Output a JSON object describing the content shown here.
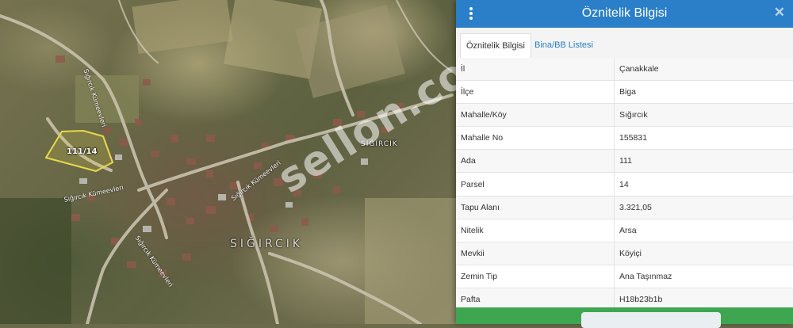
{
  "map": {
    "village_label": "SIĞIRCIK",
    "village_label_large": "SIĞIRCIK",
    "parcel_label": "111/14",
    "watermark": "sellon.com",
    "street_1": "Sığırcık Kümeevleri",
    "street_2": "Sığırcık Kümeevleri",
    "street_3": "Sığırcık Kümeevleri",
    "street_4": "Sığırcık Kümeevleri"
  },
  "panel": {
    "title": "Öznitelik Bilgisi",
    "tabs": [
      {
        "label": "Öznitelik Bilgisi",
        "active": true
      },
      {
        "label": "Bina/BB Listesi",
        "active": false
      }
    ],
    "rows": [
      {
        "key": "İl",
        "value": "Çanakkale"
      },
      {
        "key": "İlçe",
        "value": "Biga"
      },
      {
        "key": "Mahalle/Köy",
        "value": "Sığırcık"
      },
      {
        "key": "Mahalle No",
        "value": "155831"
      },
      {
        "key": "Ada",
        "value": "111"
      },
      {
        "key": "Parsel",
        "value": "14"
      },
      {
        "key": "Tapu Alanı",
        "value": "3.321,05"
      },
      {
        "key": "Nitelik",
        "value": "Arsa"
      },
      {
        "key": "Mevkii",
        "value": "Köyiçi"
      },
      {
        "key": "Zemin Tip",
        "value": "Ana Taşınmaz"
      },
      {
        "key": "Pafta",
        "value": "H18b23b1b"
      }
    ]
  },
  "colors": {
    "header": "#2a7fc8",
    "footer": "#3ea651",
    "parcel_outline": "#e8d84a",
    "tab_link": "#2a7fc8"
  },
  "icons": {
    "menu": "vertical-dots-icon",
    "close": "close-icon"
  }
}
